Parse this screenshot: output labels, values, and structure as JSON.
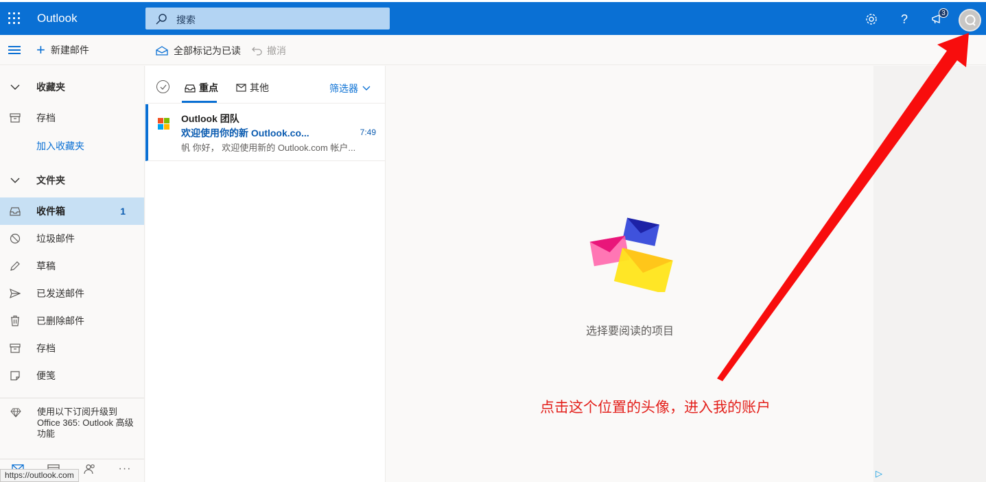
{
  "header": {
    "app_name": "Outlook",
    "search_placeholder": "搜索",
    "notification_count": "3",
    "icons": [
      "waffle-icon",
      "search-icon",
      "gear-icon",
      "help-icon",
      "megaphone-icon",
      "avatar-icon"
    ]
  },
  "toolbar": {
    "new_mail_label": "新建邮件",
    "mark_all_read_label": "全部标记为已读",
    "undo_label": "撤消"
  },
  "sidebar": {
    "favorites_header": "收藏夹",
    "favorites": [
      {
        "label": "存档",
        "icon": "archive-icon"
      }
    ],
    "add_favorite_label": "加入收藏夹",
    "folders_header": "文件夹",
    "folders": [
      {
        "label": "收件箱",
        "count": "1",
        "icon": "inbox-icon",
        "selected": true
      },
      {
        "label": "垃圾邮件",
        "count": "",
        "icon": "junk-icon"
      },
      {
        "label": "草稿",
        "count": "",
        "icon": "pencil-icon"
      },
      {
        "label": "已发送邮件",
        "count": "",
        "icon": "send-icon"
      },
      {
        "label": "已删除邮件",
        "count": "",
        "icon": "trash-icon"
      },
      {
        "label": "存档",
        "count": "",
        "icon": "archive-icon"
      },
      {
        "label": "便笺",
        "count": "",
        "icon": "note-icon"
      }
    ],
    "upgrade_text": "使用以下订阅升级到 Office 365: Outlook 高级功能",
    "status_url": "https://outlook.com"
  },
  "message_list": {
    "tab_focused": "重点",
    "tab_other": "其他",
    "filter_label": "筛选器",
    "messages": [
      {
        "sender": "Outlook 团队",
        "subject": "欢迎使用你的新 Outlook.co...",
        "time": "7:49",
        "preview": "帆 你好， 欢迎使用新的 Outlook.com 帐户..."
      }
    ]
  },
  "reading_pane": {
    "empty_text": "选择要阅读的项目"
  },
  "annotation": {
    "text": "点击这个位置的头像，进入我的账户",
    "color": "#e3201b"
  },
  "colors": {
    "brand": "#0a70d4",
    "selected_bg": "#c7e0f4"
  }
}
